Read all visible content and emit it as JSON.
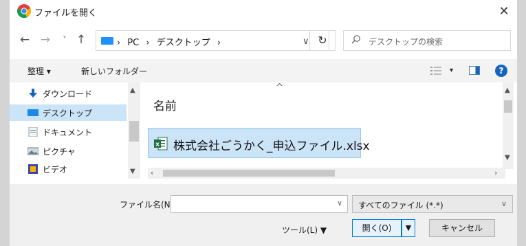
{
  "window": {
    "title": "ファイルを開く",
    "close_glyph": "✕"
  },
  "nav": {
    "back": "←",
    "forward": "→",
    "recent": "˅",
    "up": "↑",
    "breadcrumb": [
      "›",
      "PC",
      "›",
      "デスクトップ",
      "›"
    ],
    "address_dropdown": "∨",
    "refresh": "↻",
    "search_placeholder": "デスクトップの検索"
  },
  "toolbar": {
    "organize": "整理 ▾",
    "new_folder": "新しいフォルダー",
    "view_menu": "▾",
    "help": "?"
  },
  "tree": {
    "items": [
      {
        "label": "ダウンロード",
        "icon": "download-arrow-icon",
        "selected": false
      },
      {
        "label": "デスクトップ",
        "icon": "desktop-icon",
        "selected": true
      },
      {
        "label": "ドキュメント",
        "icon": "document-icon",
        "selected": false
      },
      {
        "label": "ピクチャ",
        "icon": "picture-icon",
        "selected": false
      },
      {
        "label": "ビデオ",
        "icon": "video-icon",
        "selected": false
      }
    ]
  },
  "filelist": {
    "column_name": "名前",
    "files": [
      {
        "name": "株式会社ごうかく_申込ファイル.xlsx",
        "icon": "excel-file-icon",
        "selected": true
      }
    ]
  },
  "bottom": {
    "filename_label": "ファイル名(N):",
    "filename_value": "",
    "filetype_value": "すべてのファイル (*.*)",
    "tools_label": "ツール(L)  ▼",
    "open_label": "開く(O)",
    "cancel_label": "キャンセル"
  },
  "colors": {
    "selection_bg": "#cce4f7",
    "accent": "#0078d7",
    "excel_green": "#1d6f42"
  }
}
